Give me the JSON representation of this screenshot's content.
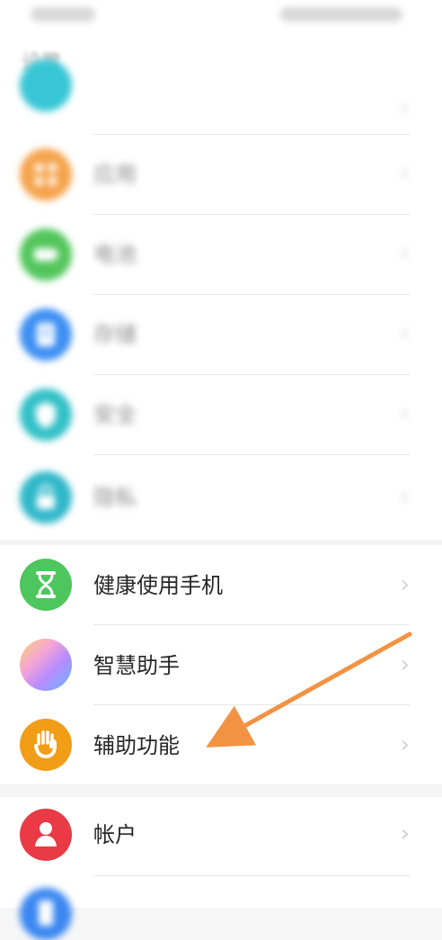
{
  "status_bar": {
    "left_text": "",
    "right_text": ""
  },
  "header": {
    "title": "设置"
  },
  "items": [
    {
      "label": "",
      "subtitle": "",
      "icon": "grid-icon",
      "color": "#38c6d6"
    },
    {
      "label": "应用",
      "icon": "grid-icon",
      "color": "#f5a34b"
    },
    {
      "label": "电池",
      "icon": "battery-icon",
      "color": "#52c65b"
    },
    {
      "label": "存储",
      "icon": "storage-icon",
      "color": "#3d8ff2"
    },
    {
      "label": "安全",
      "icon": "shield-icon",
      "color": "#32c0c7"
    },
    {
      "label": "隐私",
      "icon": "lock-icon",
      "color": "#2fb7c9"
    },
    {
      "label": "健康使用手机",
      "icon": "hourglass-icon",
      "color": "#4cc65d"
    },
    {
      "label": "智慧助手",
      "icon": "gradient-orb-icon",
      "color": "#f4a6d1"
    },
    {
      "label": "辅助功能",
      "icon": "hand-icon",
      "color": "#f19d17"
    },
    {
      "label": "帐户",
      "icon": "person-icon",
      "color": "#e93a46"
    },
    {
      "label": "",
      "icon": "phone-icon",
      "color": "#3b87f1"
    }
  ],
  "colors": {
    "accent_arrow": "#f29343",
    "background": "#f6f6f6",
    "card": "#ffffff"
  }
}
